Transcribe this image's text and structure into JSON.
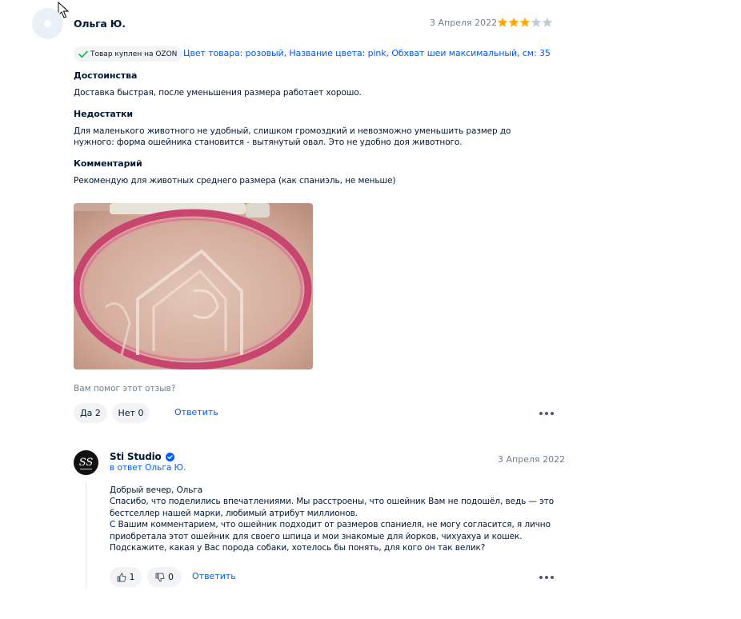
{
  "review": {
    "author": "Ольга Ю.",
    "date": "3 Апреля 2022",
    "rating": 3,
    "rating_max": 5,
    "purchase_badge": "Товар куплен на OZON",
    "variant": "Цвет товара: розовый, Название цвета: pink, Обхват шеи максимальный, см: 35",
    "sections": [
      {
        "title": "Достоинства",
        "text": "Доставка быстрая, после уменьшения размера работает хорошо."
      },
      {
        "title": "Недостатки",
        "text": "Для маленького животного не удобный, слишком громоздкий и невозможно уменьшить размер до нужного: форма ошейника становится - вытянутый овал. Это не удобно доя животного."
      },
      {
        "title": "Комментарий",
        "text": "Рекомендую для животных среднего размера (как спаниэль, не меньше)"
      }
    ],
    "helpful_question": "Вам помог этот отзыв?",
    "yes_label": "Да 2",
    "no_label": "Нет 0",
    "reply_label": "Ответить"
  },
  "seller_reply": {
    "name": "Sti Studio",
    "reply_to": "в ответ Ольга Ю.",
    "date": "3 Апреля 2022",
    "paragraphs": [
      "Добрый вечер, Ольга",
      "Спасибо, что поделились впечатлениями. Мы расстроены, что ошейник Вам не подошёл, ведь — это бестселлер нашей марки, любимый атрибут миллионов.",
      "С Вашим комментарием, что ошейник подходит от размеров спаниеля, не могу согласится, я лично приобретала этот ошейник для своего шпица и мои знакомые для йорков, чихуахуа и кошек. Подскажите, какая у Вас порода собаки, хотелось бы понять, для кого он так велик?"
    ],
    "likes": "1",
    "dislikes": "0",
    "reply_label": "Ответить"
  },
  "colors": {
    "link": "#005bff",
    "star_filled": "#ffa800",
    "star_empty": "#c4cbd2",
    "check": "#10c44c"
  }
}
